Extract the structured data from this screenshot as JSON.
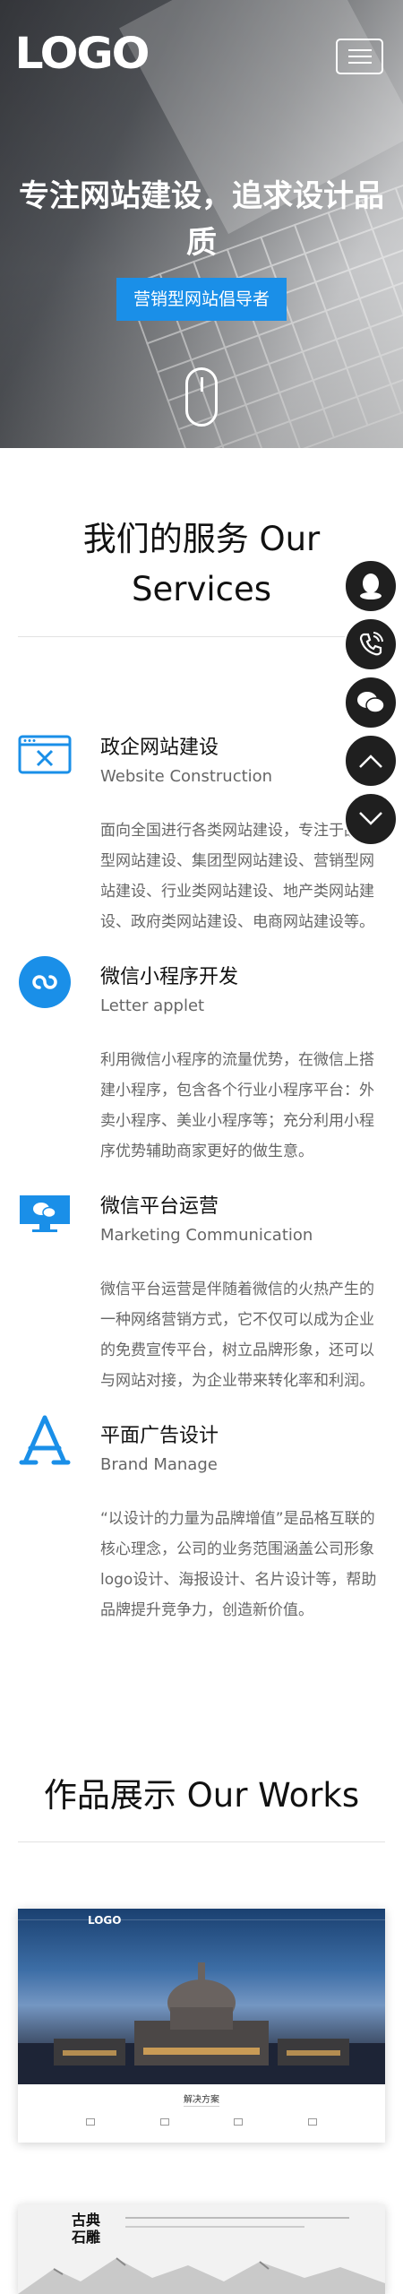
{
  "header": {
    "logo": "LOGO",
    "hero_title": "专注网站建设，追求设计品质",
    "hero_button": "营销型网站倡导者"
  },
  "services": {
    "title": "我们的服务 Our Services",
    "items": [
      {
        "name": "政企网站建设",
        "en": "Website Construction",
        "desc": "面向全国进行各类网站建设，专注于品牌型网站建设、集团型网站建设、营销型网站建设、行业类网站建设、地产类网站建设、政府类网站建设、电商网站建设等。",
        "icon": "browser-settings-icon"
      },
      {
        "name": "微信小程序开发",
        "en": "Letter applet",
        "desc": "利用微信小程序的流量优势，在微信上搭建小程序，包含各个行业小程序平台：外卖小程序、美业小程序等；充分利用小程序优势辅助商家更好的做生意。",
        "icon": "mini-program-icon"
      },
      {
        "name": "微信平台运营",
        "en": "Marketing Communication",
        "desc": "微信平台运营是伴随着微信的火热产生的一种网络营销方式，它不仅可以成为企业的免费宣传平台，树立品牌形象，还可以与网站对接，为企业带来转化率和利润。",
        "icon": "wechat-monitor-icon"
      },
      {
        "name": "平面广告设计",
        "en": "Brand Manage",
        "desc": "“以设计的力量为品牌增值”是品格互联的核心理念，公司的业务范围涵盖公司形象logo设计、海报设计、名片设计等，帮助品牌提升竞争力，创造新价值。",
        "icon": "app-store-icon"
      }
    ]
  },
  "works": {
    "title": "作品展示 Our Works",
    "items": [
      {
        "logo": "LOGO",
        "caption": "解决方案"
      },
      {
        "logo": "古典石雕"
      }
    ]
  },
  "float": [
    "qq-icon",
    "phone-icon",
    "wechat-icon",
    "chevron-up-icon",
    "chevron-down-icon"
  ],
  "colors": {
    "accent": "#1a8fe8",
    "float_bg": "#1f1f1f"
  }
}
